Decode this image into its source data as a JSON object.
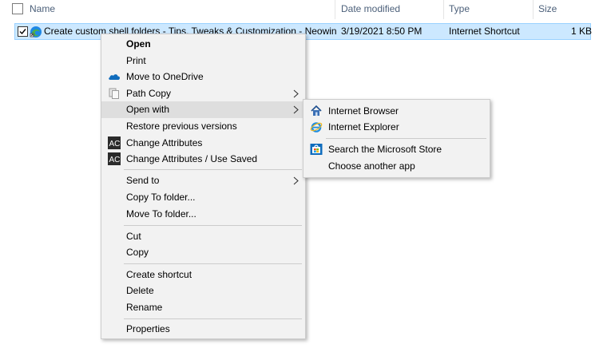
{
  "columns": {
    "name": "Name",
    "date_modified": "Date modified",
    "type": "Type",
    "size": "Size"
  },
  "file": {
    "name": "Create custom shell folders - Tips, Tweaks & Customization - Neowin",
    "date_modified": "3/19/2021 8:50 PM",
    "type": "Internet Shortcut",
    "size": "1 KB"
  },
  "context_menu": {
    "open": "Open",
    "print": "Print",
    "move_to_onedrive": "Move to OneDrive",
    "path_copy": "Path Copy",
    "open_with": "Open with",
    "restore_previous_versions": "Restore previous versions",
    "change_attributes": "Change Attributes",
    "change_attributes_use_saved": "Change Attributes / Use Saved",
    "send_to": "Send to",
    "copy_to_folder": "Copy To folder...",
    "move_to_folder": "Move To folder...",
    "cut": "Cut",
    "copy": "Copy",
    "create_shortcut": "Create shortcut",
    "delete": "Delete",
    "rename": "Rename",
    "properties": "Properties"
  },
  "open_with_menu": {
    "internet_browser": "Internet Browser",
    "internet_explorer": "Internet Explorer",
    "search_store": "Search the Microsoft Store",
    "choose_another_app": "Choose another app"
  },
  "icon_text": {
    "ac_badge": "AC"
  },
  "colors": {
    "selection_bg": "#cce8ff",
    "selection_border": "#99d1ff",
    "menu_bg": "#f2f2f2",
    "highlight_bg": "#dedede",
    "header_text": "#4c607a",
    "onedrive_blue": "#0f6cbd"
  }
}
